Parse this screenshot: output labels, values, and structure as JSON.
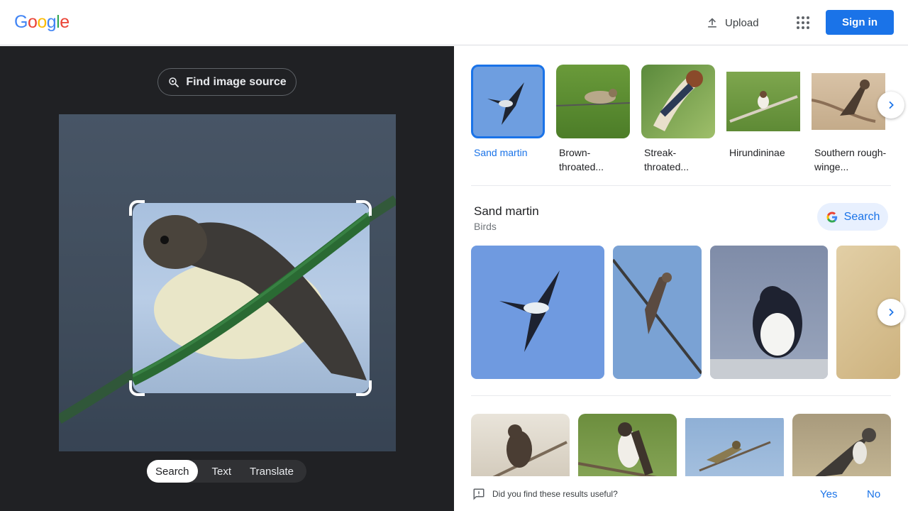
{
  "header": {
    "logo_letters": [
      {
        "ch": "G",
        "color": "#4285F4"
      },
      {
        "ch": "o",
        "color": "#EA4335"
      },
      {
        "ch": "o",
        "color": "#FBBC05"
      },
      {
        "ch": "g",
        "color": "#4285F4"
      },
      {
        "ch": "l",
        "color": "#34A853"
      },
      {
        "ch": "e",
        "color": "#EA4335"
      }
    ],
    "upload_label": "Upload",
    "apps_icon": "apps-grid-icon",
    "signin_label": "Sign in"
  },
  "left": {
    "find_source_label": "Find image source",
    "modes": [
      {
        "label": "Search",
        "active": true
      },
      {
        "label": "Text",
        "active": false
      },
      {
        "label": "Translate",
        "active": false
      }
    ]
  },
  "categories": [
    {
      "label": "Sand martin",
      "selected": true
    },
    {
      "label": "Brown-throated...",
      "selected": false
    },
    {
      "label": "Streak-throated...",
      "selected": false
    },
    {
      "label": "Hirundininae",
      "selected": false
    },
    {
      "label": "Southern rough-winge...",
      "selected": false
    }
  ],
  "entity": {
    "title": "Sand martin",
    "subtitle": "Birds",
    "search_label": "Search"
  },
  "feedback": {
    "question": "Did you find these results useful?",
    "yes": "Yes",
    "no": "No"
  },
  "colors": {
    "accent": "#1a73e8",
    "dark_panel": "#202124"
  }
}
